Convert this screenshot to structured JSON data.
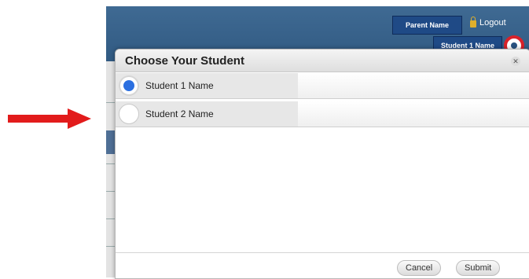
{
  "header": {
    "parent_button_label": "Parent Name",
    "logout_label": "Logout",
    "student_button_label": "Student 1 Name"
  },
  "modal": {
    "title": "Choose Your Student",
    "students": [
      {
        "name": "Student 1 Name",
        "selected": true
      },
      {
        "name": "Student 2 Name",
        "selected": false
      }
    ],
    "cancel_label": "Cancel",
    "submit_label": "Submit"
  },
  "colors": {
    "header_blue": "#315a82",
    "button_blue": "#1f4a86",
    "annotation_red": "#e21b1b",
    "radio_selected": "#2b6fe0"
  }
}
